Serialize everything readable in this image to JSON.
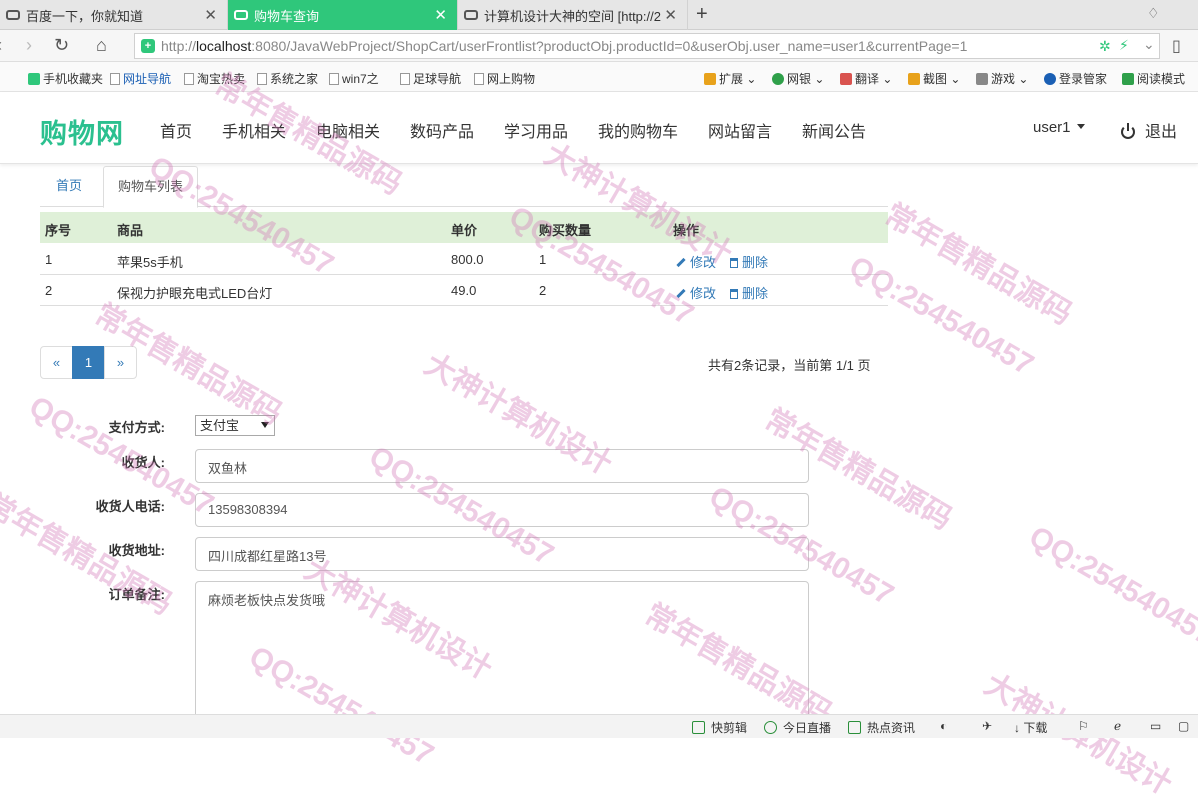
{
  "browser": {
    "tabs": [
      {
        "title": "百度一下，你就知道",
        "active": false
      },
      {
        "title": "购物车查询",
        "active": true
      },
      {
        "title": "计算机设计大神的空间 [http://2",
        "active": false
      }
    ],
    "new_tab_label": "+",
    "url": {
      "scheme": "http://",
      "host": "localhost",
      "rest": ":8080/JavaWebProject/ShopCart/userFrontlist?productObj.productId=0&userObj.user_name=user1&currentPage=1"
    },
    "bookmarks": [
      "手机收藏夹",
      "网址导航",
      "淘宝热卖",
      "系统之家",
      "win7之",
      "足球导航",
      "网上购物"
    ],
    "extensions": [
      "扩展",
      "网银",
      "翻译",
      "截图",
      "游戏",
      "登录管家",
      "阅读模式"
    ],
    "status_bar": [
      "快剪辑",
      "今日直播",
      "热点资讯",
      "下载"
    ]
  },
  "site": {
    "logo": "购物网",
    "nav": [
      "首页",
      "手机相关",
      "电脑相关",
      "数码产品",
      "学习用品",
      "我的购物车",
      "网站留言",
      "新闻公告"
    ],
    "user": "user1",
    "logout": "退出"
  },
  "breadcrumb_tabs": {
    "home": "首页",
    "current": "购物车列表"
  },
  "table": {
    "columns": [
      "序号",
      "商品",
      "单价",
      "购买数量",
      "操作"
    ],
    "rows": [
      {
        "index": "1",
        "product": "苹果5s手机",
        "price": "800.0",
        "qty": "1"
      },
      {
        "index": "2",
        "product": "保视力护眼充电式LED台灯",
        "price": "49.0",
        "qty": "2"
      }
    ],
    "edit_label": "修改",
    "delete_label": "删除"
  },
  "pagination": {
    "prev": "«",
    "page": "1",
    "next": "»",
    "info": "共有2条记录，当前第 1/1 页"
  },
  "form": {
    "payment_label": "支付方式:",
    "payment_value": "支付宝",
    "receiver_label": "收货人:",
    "receiver_value": "双鱼林",
    "phone_label": "收货人电话:",
    "phone_value": "13598308394",
    "address_label": "收货地址:",
    "address_value": "四川成都红星路13号",
    "memo_label": "订单备注:",
    "memo_value": "麻烦老板快点发货哦"
  },
  "watermark": {
    "qq": "QQ:254540457",
    "slogan1": "常年售精品源码",
    "slogan2": "大神计算机设计"
  }
}
